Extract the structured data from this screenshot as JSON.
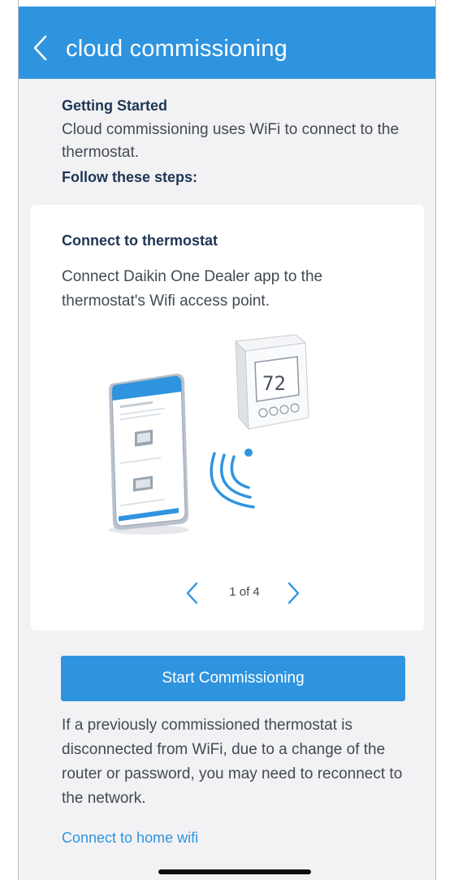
{
  "header": {
    "title": "cloud commissioning"
  },
  "intro": {
    "heading": "Getting Started",
    "description": "Cloud commissioning uses WiFi to connect to the thermostat.",
    "steps_heading": "Follow these steps:"
  },
  "card": {
    "title": "Connect to thermostat",
    "description": "Connect Daikin One Dealer app to the thermostat's Wifi access point.",
    "thermostat_temp": "72"
  },
  "pager": {
    "label": "1 of 4"
  },
  "actions": {
    "start_label": "Start Commissioning"
  },
  "note": {
    "text": "If a previously commissioned thermostat is disconnected from WiFi, due to a change of the router or password, you may need to reconnect to the network."
  },
  "links": {
    "home_wifi": "Connect to home wifi"
  },
  "colors": {
    "accent": "#2f94df",
    "heading": "#1e3653",
    "body_text": "#414a55",
    "background": "#f2f2f4"
  }
}
